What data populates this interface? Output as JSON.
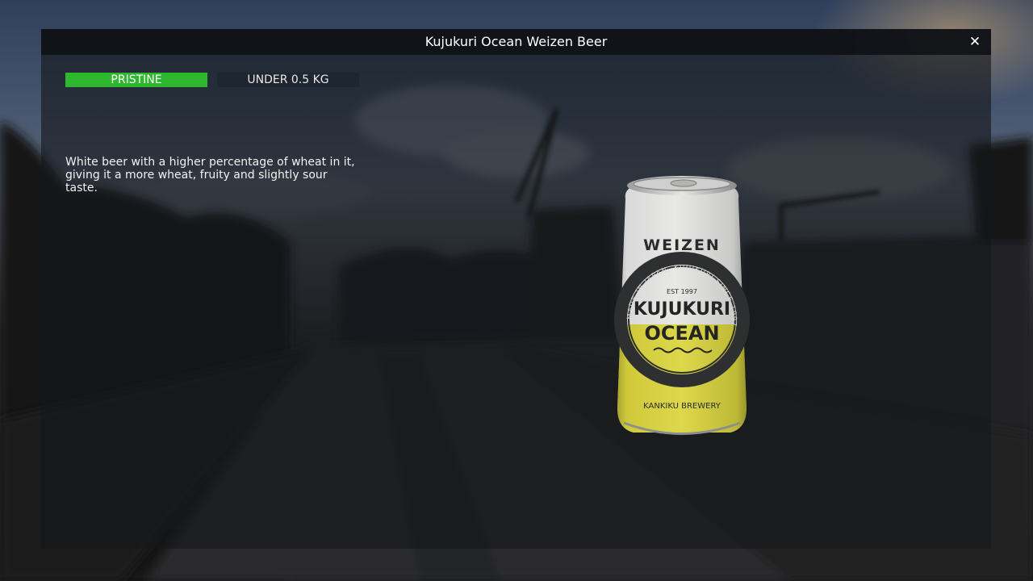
{
  "window": {
    "title": "Kujukuri Ocean Weizen Beer",
    "close_icon": "close-icon",
    "close_glyph": "✕"
  },
  "tags": {
    "condition": "PRISTINE",
    "condition_color": "#2fb82f",
    "weight": "UNDER 0.5 KG"
  },
  "item": {
    "description": "White beer with a higher percentage of wheat in it, giving it a more wheat, fruity and slightly sour taste.",
    "can": {
      "style_label": "WEIZEN",
      "est": "EST 1997",
      "ring_text": "MADE IN JAPAN, KUJUKURI SINCE 1997",
      "brand_line1": "KUJUKURI",
      "brand_line2": "OCEAN",
      "brewery": "KANKIKU BREWERY",
      "accent_color": "#d8d33a"
    }
  }
}
